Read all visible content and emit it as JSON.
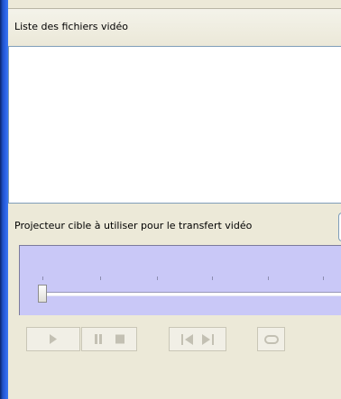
{
  "video_list": {
    "header": "Liste des fichiers vidéo"
  },
  "projector": {
    "label": "Projecteur cible à utiliser pour le transfert vidéo"
  },
  "playback": {
    "position": 0
  },
  "icons": [
    "play-icon",
    "pause-icon",
    "stop-icon",
    "previous-icon",
    "next-icon",
    "loop-icon"
  ]
}
